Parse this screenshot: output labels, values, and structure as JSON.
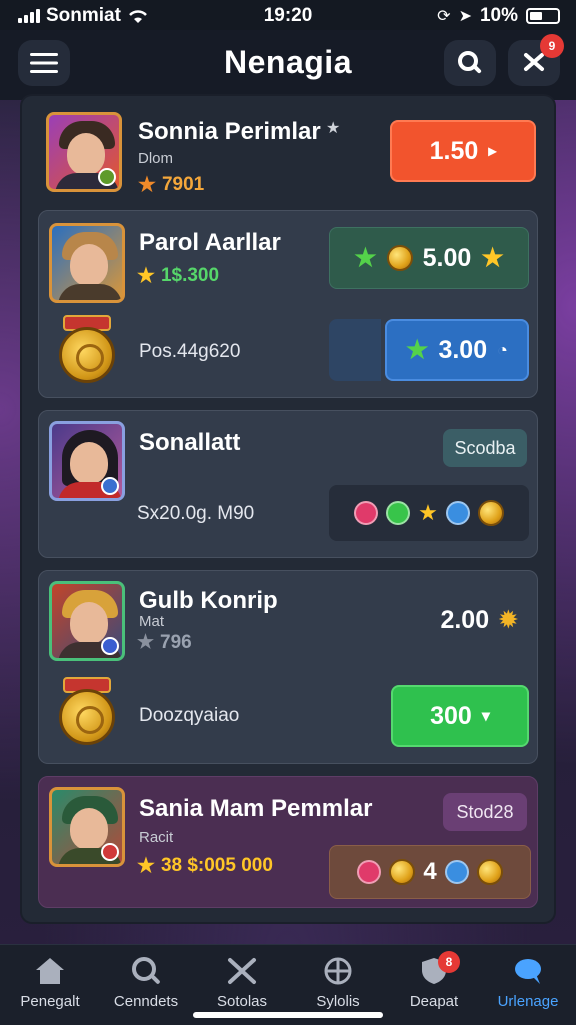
{
  "status": {
    "carrier": "Sonmiat",
    "time": "19:20",
    "battery": "10%"
  },
  "header": {
    "title": "Nenagia",
    "notification_count": "9"
  },
  "cards": [
    {
      "name": "Sonnia Perimlar",
      "role": "Dlom",
      "stat": "7901",
      "price": "1.50",
      "price_color": "#f2542d"
    },
    {
      "name": "Parol Aarllar",
      "stat": "1$.300",
      "stat_color": "#56d66a",
      "price": "5.00",
      "price_color": "#2f5b4b",
      "medal_label": "Pos.44g620",
      "price2": "3.00",
      "price2_color": "#2c6fc2"
    },
    {
      "name": "Sonallatt",
      "tag": "Scodba",
      "label": "Sx20.0g. M90",
      "tag_color": "#3b5e66"
    },
    {
      "name": "Gulb Konrip",
      "role": "Mat",
      "stat": "796",
      "price": "2.00",
      "medal_label": "Doozqyaiao",
      "price2": "300",
      "price2_color": "#2fc14e"
    },
    {
      "name": "Sania Mam Pemmlar",
      "role": "Racit",
      "stat": "38 $:005 000",
      "stat_color": "#ffc627",
      "tag": "Stod28",
      "tag_color": "#6a3f74",
      "gem_count": "4"
    }
  ],
  "tabs": [
    {
      "label": "Penegalt",
      "icon": "home-icon"
    },
    {
      "label": "Cenndets",
      "icon": "search-icon"
    },
    {
      "label": "Sotolas",
      "icon": "swords-icon"
    },
    {
      "label": "Sylolis",
      "icon": "globe-icon"
    },
    {
      "label": "Deapat",
      "icon": "shield-icon",
      "badge": "8"
    },
    {
      "label": "Urlenage",
      "icon": "chat-icon"
    }
  ]
}
